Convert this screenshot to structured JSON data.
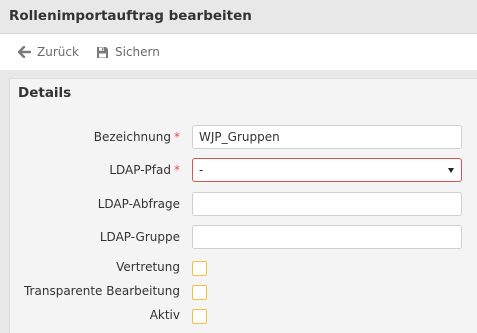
{
  "window": {
    "title": "Rollenimportauftrag bearbeiten"
  },
  "toolbar": {
    "back_label": "Zurück",
    "save_label": "Sichern"
  },
  "panel": {
    "title": "Details"
  },
  "form": {
    "bezeichnung": {
      "label": "Bezeichnung",
      "required_mark": "*",
      "value": "WJP_Gruppen"
    },
    "ldap_pfad": {
      "label": "LDAP-Pfad",
      "required_mark": "*",
      "value": "-"
    },
    "ldap_abfrage": {
      "label": "LDAP-Abfrage",
      "value": ""
    },
    "ldap_gruppe": {
      "label": "LDAP-Gruppe",
      "value": ""
    },
    "vertretung": {
      "label": "Vertretung",
      "checked": false
    },
    "transparente_bearbeitung": {
      "label": "Transparente Bearbeitung",
      "checked": false
    },
    "aktiv": {
      "label": "Aktiv",
      "checked": false
    }
  },
  "colors": {
    "required": "#d9534f",
    "checkbox_border": "#f0c040",
    "header_bg": "#e8e8e8"
  }
}
